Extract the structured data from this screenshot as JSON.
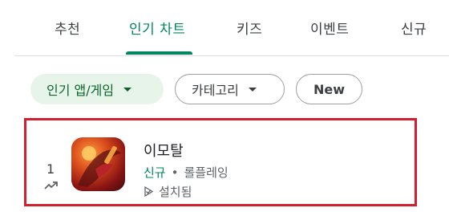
{
  "tabs": [
    {
      "label": "추천"
    },
    {
      "label": "인기 차트"
    },
    {
      "label": "키즈"
    },
    {
      "label": "이벤트"
    },
    {
      "label": "신규"
    }
  ],
  "active_tab": "인기 차트",
  "filters": {
    "type_label": "인기 앱/게임",
    "category_label": "카테고리",
    "new_label": "New"
  },
  "app": {
    "rank": "1",
    "title": "이모탈",
    "badge": "신규",
    "separator": "•",
    "genre": "롤플레잉",
    "status": "설치됨",
    "trend_icon": "trending-up-icon",
    "status_icon": "installed-icon"
  },
  "colors": {
    "accent_green": "#01875f",
    "chip_selected_bg": "#e6f4ea",
    "highlight_border": "#d02030"
  }
}
